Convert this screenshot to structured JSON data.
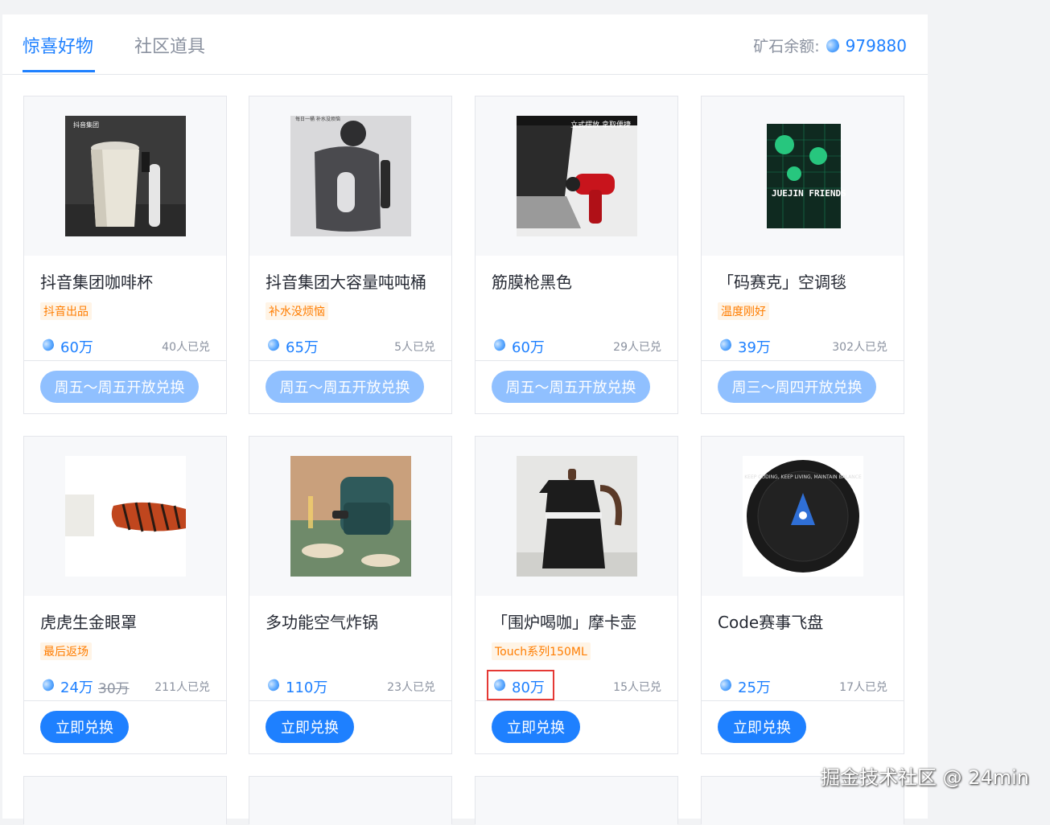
{
  "tabs": [
    {
      "label": "惊喜好物",
      "active": true
    },
    {
      "label": "社区道具",
      "active": false
    }
  ],
  "balance": {
    "label": "矿石余额:",
    "value": "979880"
  },
  "colors": {
    "accent": "#1e80ff",
    "tag": "#ff7d00",
    "disabled_button": "#90c0ff",
    "highlight": "#e53935"
  },
  "products": [
    {
      "name": "抖音集团咖啡杯",
      "tag": "抖音出品",
      "price": "60万",
      "old_price": "",
      "sold": "40人已兑",
      "button": "周五～周五开放兑换",
      "enabled": false
    },
    {
      "name": "抖音集团大容量吨吨桶",
      "tag": "补水没烦恼",
      "price": "65万",
      "old_price": "",
      "sold": "5人已兑",
      "button": "周五～周五开放兑换",
      "enabled": false
    },
    {
      "name": "筋膜枪黑色",
      "tag": "",
      "price": "60万",
      "old_price": "",
      "sold": "29人已兑",
      "button": "周五～周五开放兑换",
      "enabled": false
    },
    {
      "name": "「码赛克」空调毯",
      "tag": "温度刚好",
      "price": "39万",
      "old_price": "",
      "sold": "302人已兑",
      "button": "周三～周四开放兑换",
      "enabled": false
    },
    {
      "name": "虎虎生金眼罩",
      "tag": "最后返场",
      "price": "24万",
      "old_price": "30万",
      "sold": "211人已兑",
      "button": "立即兑换",
      "enabled": true
    },
    {
      "name": "多功能空气炸锅",
      "tag": "",
      "price": "110万",
      "old_price": "",
      "sold": "23人已兑",
      "button": "立即兑换",
      "enabled": true
    },
    {
      "name": "「围炉喝咖」摩卡壶",
      "tag": "Touch系列150ML",
      "price": "80万",
      "old_price": "",
      "sold": "15人已兑",
      "button": "立即兑换",
      "enabled": true
    },
    {
      "name": "Code赛事飞盘",
      "tag": "",
      "price": "25万",
      "old_price": "",
      "sold": "17人已兑",
      "button": "立即兑换",
      "enabled": true
    }
  ],
  "image_texts": {
    "cup_logo": "抖音集团",
    "bottle_caption": "每日一桶 补水没烦恼",
    "gun_caption": "立式摆放 拿取便捷",
    "blanket_text": "JUEJIN FRIENDS",
    "frisbee_text": "KEEP CODING, KEEP LIVING, MAINTAIN BALANCE"
  },
  "watermark": "掘金技术社区 @ 24min"
}
